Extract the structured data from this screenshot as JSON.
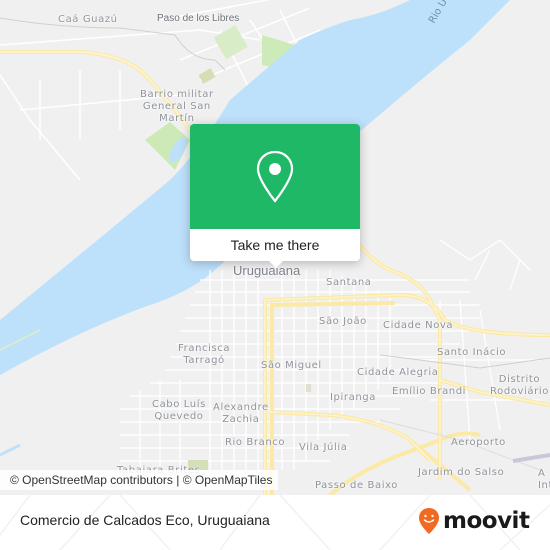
{
  "map": {
    "places": [
      {
        "id": "caa-guazu",
        "label": "Caá Guazú",
        "kind": "place"
      },
      {
        "id": "paso-de-los-libres",
        "label": "Paso de los Libres",
        "kind": "town"
      },
      {
        "id": "barrio-militar",
        "label": "Barrio militar\nGeneral San\nMartín",
        "kind": "place"
      },
      {
        "id": "uruguaiana",
        "label": "Uruguaiana",
        "kind": "city"
      },
      {
        "id": "santana",
        "label": "Santana",
        "kind": "place"
      },
      {
        "id": "sao-joao",
        "label": "São João",
        "kind": "place"
      },
      {
        "id": "cidade-nova",
        "label": "Cidade Nova",
        "kind": "place"
      },
      {
        "id": "francisca-tarrago",
        "label": "Francisca\nTarragó",
        "kind": "place"
      },
      {
        "id": "sao-miguel",
        "label": "São Miguel",
        "kind": "place"
      },
      {
        "id": "santo-inacio",
        "label": "Santo Inácio",
        "kind": "place"
      },
      {
        "id": "cidade-alegria",
        "label": "Cidade Alegria",
        "kind": "place"
      },
      {
        "id": "distrito-rodoviario",
        "label": "Distrito\nRodoviário",
        "kind": "place"
      },
      {
        "id": "cabo-luis-quevedo",
        "label": "Cabo Luís\nQuevedo",
        "kind": "place"
      },
      {
        "id": "alexandre-zachia",
        "label": "Alexandre\nZachia",
        "kind": "place"
      },
      {
        "id": "ipiranga",
        "label": "Ipiranga",
        "kind": "place"
      },
      {
        "id": "emilio-brandi",
        "label": "Emílio Brandi",
        "kind": "place"
      },
      {
        "id": "rio-branco",
        "label": "Rio Branco",
        "kind": "place"
      },
      {
        "id": "vila-julia",
        "label": "Vila Júlia",
        "kind": "place"
      },
      {
        "id": "aeroporto",
        "label": "Aeroporto",
        "kind": "place"
      },
      {
        "id": "jardim-do-salso",
        "label": "Jardim do Salso",
        "kind": "place"
      },
      {
        "id": "tabajara-brites",
        "label": "Tabajara Brites",
        "kind": "place"
      },
      {
        "id": "passo-de-baixo",
        "label": "Passo de Baixo",
        "kind": "place"
      },
      {
        "id": "aeroporto-int",
        "label": "A\nInt",
        "kind": "place"
      }
    ],
    "river_label": "Rio U",
    "colors": {
      "water": "#bde0fb",
      "land": "#f0f0f0",
      "road_major": "#fbe9a6",
      "park": "#d4ecc4",
      "popup": "#1fb866"
    }
  },
  "popup": {
    "icon": "map-pin-icon",
    "button_label": "Take me there"
  },
  "attribution": "© OpenStreetMap contributors | © OpenMapTiles",
  "footer": {
    "title": "Comercio de Calcados Eco, Uruguaiana",
    "brand": "moovit",
    "brand_color": "#f26a21"
  }
}
